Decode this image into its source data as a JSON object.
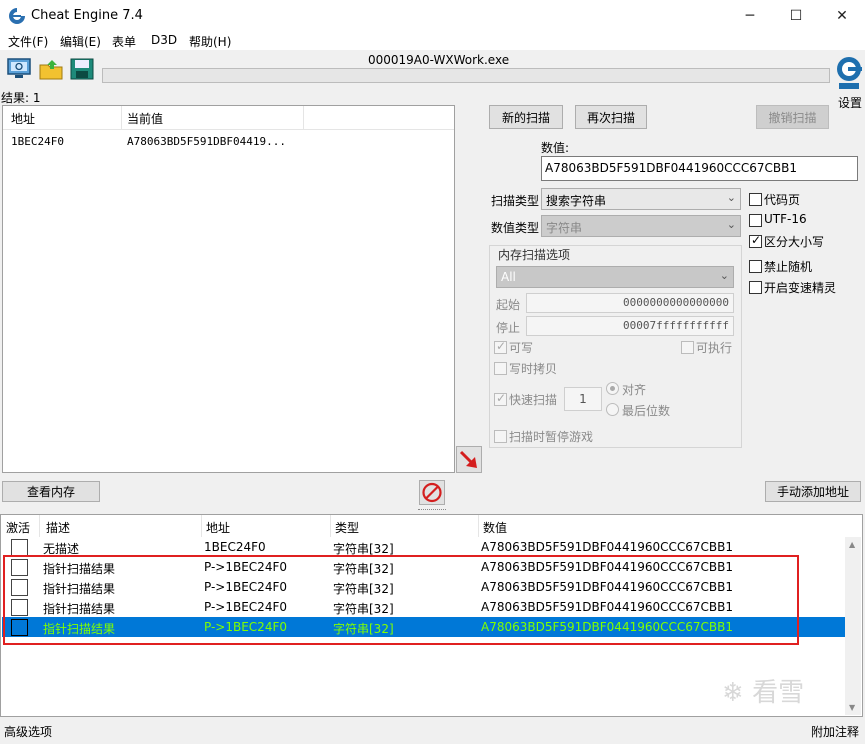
{
  "window": {
    "title": "Cheat Engine 7.4",
    "minimize": "─",
    "maximize": "☐",
    "close": "✕"
  },
  "menu": [
    "文件(F)",
    "编辑(E)",
    "表单",
    "D3D",
    "帮助(H)"
  ],
  "process_name": "000019A0-WXWork.exe",
  "settings_label": "设置",
  "found_label": "结果: 1",
  "results": {
    "columns": [
      "地址",
      "当前值"
    ],
    "rows": [
      {
        "address": "1BEC24F0",
        "value": "A78063BD5F591DBF04419..."
      }
    ]
  },
  "scan": {
    "new_scan": "新的扫描",
    "next_scan": "再次扫描",
    "undo_scan": "撤销扫描",
    "value_label": "数值:",
    "value": "A78063BD5F591DBF0441960CCC67CBB1",
    "scan_type_label": "扫描类型",
    "scan_type": "搜索字符串",
    "value_type_label": "数值类型",
    "value_type": "字符串",
    "options": {
      "codepage": "代码页",
      "utf16": "UTF-16",
      "case_sensitive": "区分大小写",
      "no_random": "禁止随机",
      "speedhack": "开启变速精灵"
    },
    "memory": {
      "title": "内存扫描选项",
      "region": "All",
      "start_label": "起始",
      "start": "0000000000000000",
      "stop_label": "停止",
      "stop": "00007fffffffffff",
      "writable": "可写",
      "executable": "可执行",
      "copy_on_write": "写时拷贝",
      "fast_scan": "快速扫描",
      "fast_scan_value": "1",
      "align": "对齐",
      "last_digits": "最后位数",
      "pause": "扫描时暂停游戏"
    }
  },
  "buttons": {
    "view_memory": "查看内存",
    "add_address": "手动添加地址"
  },
  "table": {
    "columns": [
      "激活",
      "描述",
      "地址",
      "类型",
      "数值"
    ],
    "rows": [
      {
        "desc": "无描述",
        "address": "1BEC24F0",
        "type": "字符串[32]",
        "value": "A78063BD5F591DBF0441960CCC67CBB1",
        "checkbox": false
      },
      {
        "desc": "指针扫描结果",
        "address": "P->1BEC24F0",
        "type": "字符串[32]",
        "value": "A78063BD5F591DBF0441960CCC67CBB1",
        "checkbox": true
      },
      {
        "desc": "指针扫描结果",
        "address": "P->1BEC24F0",
        "type": "字符串[32]",
        "value": "A78063BD5F591DBF0441960CCC67CBB1",
        "checkbox": true
      },
      {
        "desc": "指针扫描结果",
        "address": "P->1BEC24F0",
        "type": "字符串[32]",
        "value": "A78063BD5F591DBF0441960CCC67CBB1",
        "checkbox": true
      },
      {
        "desc": "指针扫描结果",
        "address": "P->1BEC24F0",
        "type": "字符串[32]",
        "value": "A78063BD5F591DBF0441960CCC67CBB1",
        "checkbox": true,
        "selected": true
      }
    ]
  },
  "status": {
    "advanced": "高级选项",
    "comments": "附加注释"
  },
  "watermark": "看雪",
  "colors": {
    "selection": "#0078d7",
    "selected_text": "#80ff00",
    "highlight_box": "#e02020"
  }
}
